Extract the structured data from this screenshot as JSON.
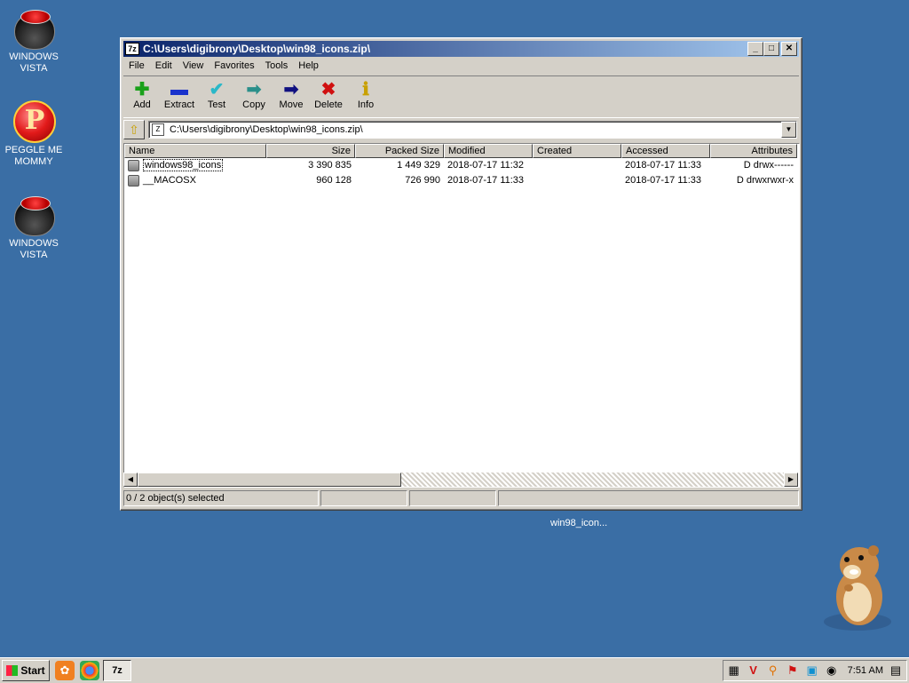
{
  "desktop": {
    "icons": [
      {
        "label1": "WINDOWS",
        "label2": "VISTA",
        "icon": "windows-vista-icon"
      },
      {
        "label1": "PEGGLE ME",
        "label2": "MOMMY",
        "icon": "peggle-icon"
      },
      {
        "label1": "WINDOWS",
        "label2": "VISTA",
        "icon": "windows-vista-icon"
      }
    ],
    "floating_label": "win98_icon..."
  },
  "window": {
    "title": "C:\\Users\\digibrony\\Desktop\\win98_icons.zip\\",
    "app_icon_text": "7z",
    "menu": [
      "File",
      "Edit",
      "View",
      "Favorites",
      "Tools",
      "Help"
    ],
    "toolbar": [
      {
        "label": "Add",
        "icon": "plus-icon",
        "glyph": "✚",
        "color": "#1aa11a"
      },
      {
        "label": "Extract",
        "icon": "minus-icon",
        "glyph": "▬",
        "color": "#1a33cc"
      },
      {
        "label": "Test",
        "icon": "check-icon",
        "glyph": "✔",
        "color": "#2ab8c8"
      },
      {
        "label": "Copy",
        "icon": "copy-arrow-icon",
        "glyph": "➡",
        "color": "#2a8f8a"
      },
      {
        "label": "Move",
        "icon": "move-arrow-icon",
        "glyph": "➡",
        "color": "#101080"
      },
      {
        "label": "Delete",
        "icon": "delete-x-icon",
        "glyph": "✖",
        "color": "#d01010"
      },
      {
        "label": "Info",
        "icon": "info-icon",
        "glyph": "ℹ",
        "color": "#c8a000"
      }
    ],
    "address": "C:\\Users\\digibrony\\Desktop\\win98_icons.zip\\",
    "columns": [
      "Name",
      "Size",
      "Packed Size",
      "Modified",
      "Created",
      "Accessed",
      "Attributes"
    ],
    "rows": [
      {
        "name": "windows98_icons",
        "size": "3 390 835",
        "packed": "1 449 329",
        "modified": "2018-07-17 11:32",
        "created": "",
        "accessed": "2018-07-17 11:33",
        "attributes": "D drwx------"
      },
      {
        "name": "__MACOSX",
        "size": "960 128",
        "packed": "726 990",
        "modified": "2018-07-17 11:33",
        "created": "",
        "accessed": "2018-07-17 11:33",
        "attributes": "D drwxrwxr-x"
      }
    ],
    "status": [
      "0 / 2 object(s) selected",
      "",
      "",
      ""
    ]
  },
  "taskbar": {
    "start_label": "Start",
    "task_button": "7z",
    "clock": "7:51 AM"
  },
  "colors": {
    "desktop": "#3a6ea5",
    "title_start": "#0a246a",
    "title_end": "#a6caf0"
  }
}
